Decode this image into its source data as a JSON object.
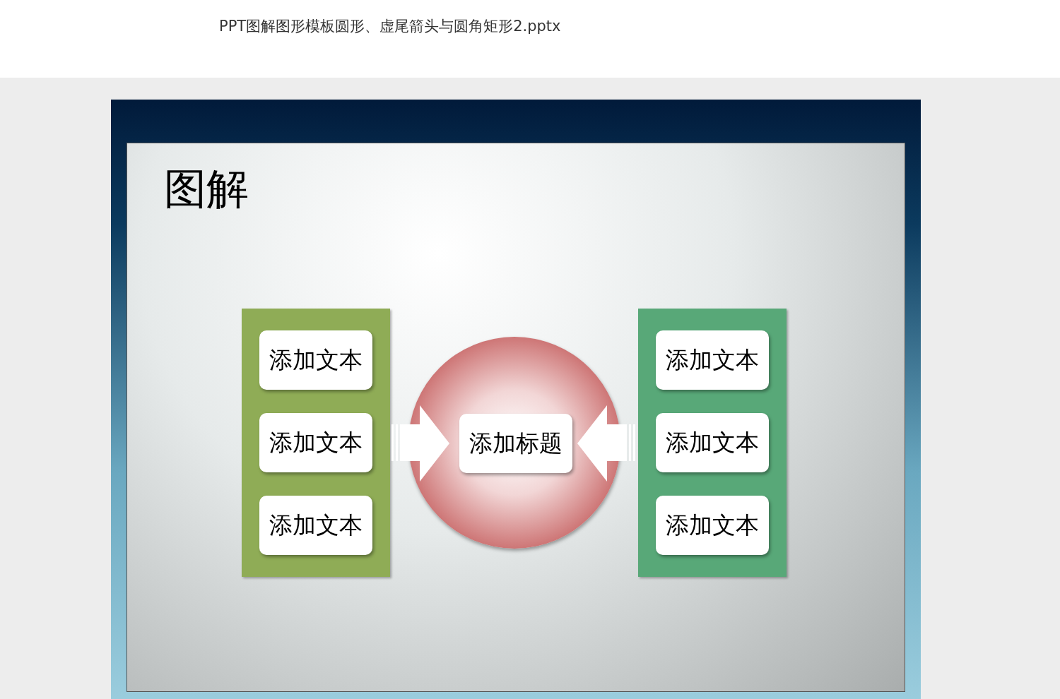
{
  "document": {
    "title": "PPT图解图形模板圆形、虚尾箭头与圆角矩形2.pptx"
  },
  "slide": {
    "title": "图解",
    "side_panels": [
      {
        "color": "#8fac56",
        "items": [
          "添加文本",
          "添加文本",
          "添加文本"
        ]
      },
      {
        "color": "#58a878",
        "items": [
          "添加文本",
          "添加文本",
          "添加文本"
        ]
      }
    ],
    "center": {
      "label": "添加标题"
    }
  }
}
